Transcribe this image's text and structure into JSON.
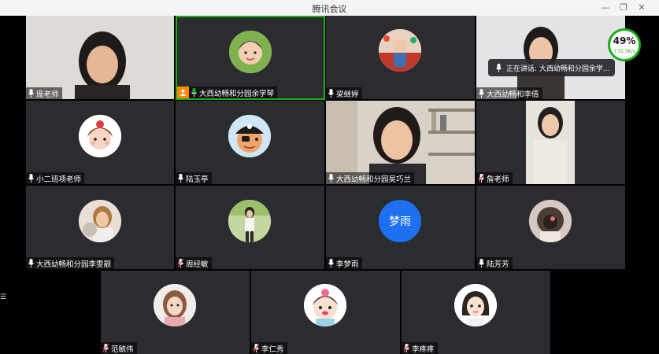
{
  "window": {
    "title": "腾讯会议"
  },
  "network": {
    "percent": "49%",
    "speed": "↑31.5K/s",
    "status_color": "#1aad19"
  },
  "speaking_popup": {
    "text": "正在讲话: 大西幼畅和分园余学..."
  },
  "colors": {
    "tile_bg": "#2b2c30",
    "speaking_border": "#1aad19",
    "host_badge": "#ff8a00",
    "initials_avatar": "#1e6ff2"
  },
  "participants": [
    {
      "name": "庞老师",
      "mic": "on",
      "view": "camera"
    },
    {
      "name": "大西幼畅和分园余学琴",
      "mic": "on",
      "view": "avatar",
      "speaking": true,
      "host": true
    },
    {
      "name": "梁继婷",
      "mic": "on",
      "view": "avatar"
    },
    {
      "name": "大西幼畅和李倩",
      "mic": "on",
      "view": "camera"
    },
    {
      "name": "小二班项老师",
      "mic": "on",
      "view": "avatar"
    },
    {
      "name": "陆玉亭",
      "mic": "on",
      "view": "avatar"
    },
    {
      "name": "大西幼畅和分园吴巧兰",
      "mic": "on",
      "view": "camera"
    },
    {
      "name": "詹老师",
      "mic": "muted",
      "view": "camera"
    },
    {
      "name": "大西幼畅和分园李雯靓",
      "mic": "on",
      "view": "avatar"
    },
    {
      "name": "周经敏",
      "mic": "muted",
      "view": "avatar"
    },
    {
      "name": "李梦雨",
      "mic": "on",
      "view": "initials",
      "initials": "梦雨"
    },
    {
      "name": "陆芳芳",
      "mic": "on",
      "view": "avatar"
    },
    {
      "name": "范毓伟",
      "mic": "muted",
      "view": "avatar"
    },
    {
      "name": "李仁秀",
      "mic": "muted",
      "view": "avatar"
    },
    {
      "name": "李疼疼",
      "mic": "muted",
      "view": "avatar"
    }
  ]
}
